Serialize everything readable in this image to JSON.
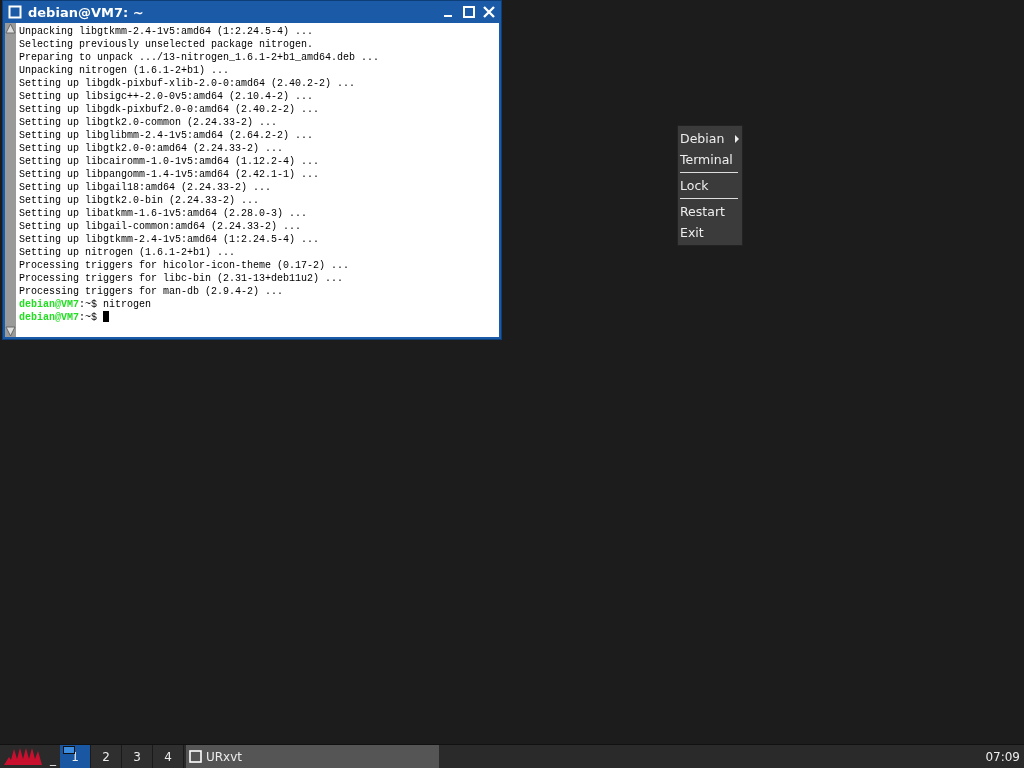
{
  "terminal": {
    "title": "debian@VM7: ~",
    "lines": [
      {
        "kind": "output",
        "text": "Unpacking libgtkmm-2.4-1v5:amd64 (1:2.24.5-4) ..."
      },
      {
        "kind": "output",
        "text": "Selecting previously unselected package nitrogen."
      },
      {
        "kind": "output",
        "text": "Preparing to unpack .../13-nitrogen_1.6.1-2+b1_amd64.deb ..."
      },
      {
        "kind": "output",
        "text": "Unpacking nitrogen (1.6.1-2+b1) ..."
      },
      {
        "kind": "output",
        "text": "Setting up libgdk-pixbuf-xlib-2.0-0:amd64 (2.40.2-2) ..."
      },
      {
        "kind": "output",
        "text": "Setting up libsigc++-2.0-0v5:amd64 (2.10.4-2) ..."
      },
      {
        "kind": "output",
        "text": "Setting up libgdk-pixbuf2.0-0:amd64 (2.40.2-2) ..."
      },
      {
        "kind": "output",
        "text": "Setting up libgtk2.0-common (2.24.33-2) ..."
      },
      {
        "kind": "output",
        "text": "Setting up libglibmm-2.4-1v5:amd64 (2.64.2-2) ..."
      },
      {
        "kind": "output",
        "text": "Setting up libgtk2.0-0:amd64 (2.24.33-2) ..."
      },
      {
        "kind": "output",
        "text": "Setting up libcairomm-1.0-1v5:amd64 (1.12.2-4) ..."
      },
      {
        "kind": "output",
        "text": "Setting up libpangomm-1.4-1v5:amd64 (2.42.1-1) ..."
      },
      {
        "kind": "output",
        "text": "Setting up libgail18:amd64 (2.24.33-2) ..."
      },
      {
        "kind": "output",
        "text": "Setting up libgtk2.0-bin (2.24.33-2) ..."
      },
      {
        "kind": "output",
        "text": "Setting up libatkmm-1.6-1v5:amd64 (2.28.0-3) ..."
      },
      {
        "kind": "output",
        "text": "Setting up libgail-common:amd64 (2.24.33-2) ..."
      },
      {
        "kind": "output",
        "text": "Setting up libgtkmm-2.4-1v5:amd64 (1:2.24.5-4) ..."
      },
      {
        "kind": "output",
        "text": "Setting up nitrogen (1.6.1-2+b1) ..."
      },
      {
        "kind": "output",
        "text": "Processing triggers for hicolor-icon-theme (0.17-2) ..."
      },
      {
        "kind": "output",
        "text": "Processing triggers for libc-bin (2.31-13+deb11u2) ..."
      },
      {
        "kind": "output",
        "text": "Processing triggers for man-db (2.9.4-2) ..."
      },
      {
        "kind": "prompt",
        "host": "debian@VM7",
        "path": ":~$",
        "command": "nitrogen",
        "cursor": false
      },
      {
        "kind": "prompt",
        "host": "debian@VM7",
        "path": ":~$",
        "cursor": true
      }
    ]
  },
  "menu": {
    "items": [
      {
        "kind": "item",
        "label": "Debian",
        "submenu": true
      },
      {
        "kind": "item",
        "label": "Terminal",
        "submenu": false
      },
      {
        "kind": "separator"
      },
      {
        "kind": "item",
        "label": "Lock",
        "submenu": false
      },
      {
        "kind": "separator"
      },
      {
        "kind": "item",
        "label": "Restart",
        "submenu": false
      },
      {
        "kind": "item",
        "label": "Exit",
        "submenu": false
      }
    ]
  },
  "taskbar": {
    "show_desktop": "_",
    "workspaces": [
      {
        "label": "1",
        "selected": true
      },
      {
        "label": "2",
        "selected": false
      },
      {
        "label": "3",
        "selected": false
      },
      {
        "label": "4",
        "selected": false
      }
    ],
    "tasks": [
      {
        "label": "URxvt"
      }
    ],
    "clock": "07:09"
  }
}
